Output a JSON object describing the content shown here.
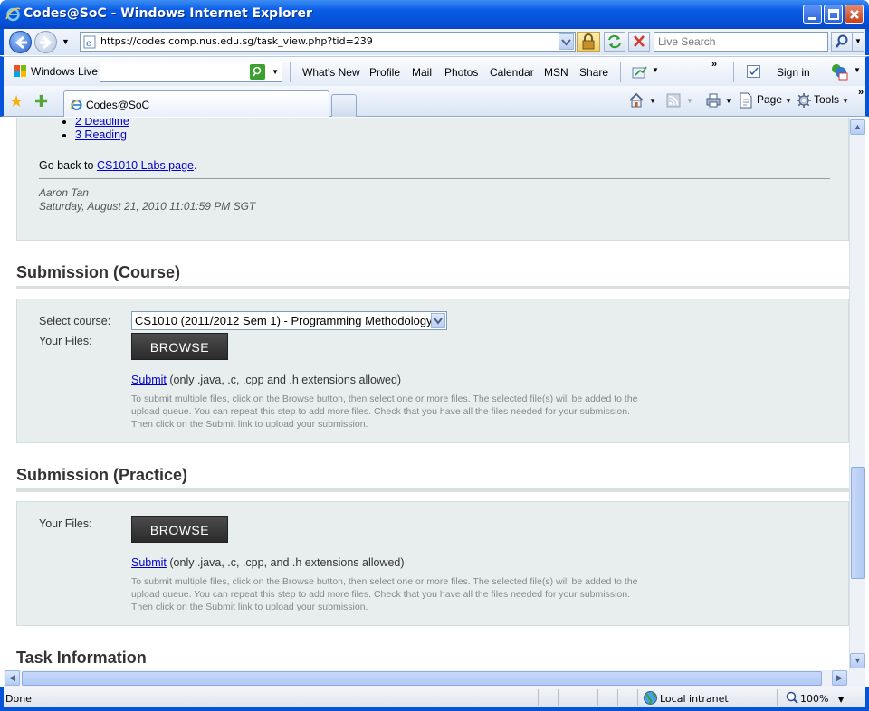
{
  "window": {
    "title": "Codes@SoC - Windows Internet Explorer"
  },
  "address_bar": {
    "url": "https://codes.comp.nus.edu.sg/task_view.php?tid=239",
    "search_placeholder": "Live Search"
  },
  "live_toolbar": {
    "brand": "Windows Live",
    "links": [
      "What's New",
      "Profile",
      "Mail",
      "Photos",
      "Calendar",
      "MSN",
      "Share"
    ],
    "sign_in": "Sign in"
  },
  "tabs": [
    {
      "label": "Codes@SoC"
    }
  ],
  "command_bar": {
    "page_label": "Page",
    "tools_label": "Tools"
  },
  "content": {
    "toc": [
      "2 Deadline",
      "3 Reading"
    ],
    "go_back_prefix": "Go back to ",
    "go_back_link": "CS1010 Labs page",
    "go_back_suffix": ".",
    "author": "Aaron Tan",
    "date": "Saturday, August 21, 2010 11:01:59 PM SGT",
    "course_section": {
      "heading": "Submission (Course)",
      "select_label": "Select course:",
      "select_value": "CS1010 (2011/2012 Sem 1) - Programming Methodology",
      "files_label": "Your Files:",
      "browse_label": "BROWSE",
      "submit_link": "Submit",
      "submit_note": " (only .java, .c, .cpp and .h extensions allowed)",
      "help_text": "To submit multiple files, click on the Browse button, then select one or more files. The selected file(s) will be added to the upload queue. You can repeat this step to add more files. Check that you have all the files needed for your submission. Then click on the Submit link to upload your submission."
    },
    "practice_section": {
      "heading": "Submission (Practice)",
      "files_label": "Your Files:",
      "browse_label": "BROWSE",
      "submit_link": "Submit",
      "submit_note": " (only .java, .c, .cpp, and .h extensions allowed)",
      "help_text": "To submit multiple files, click on the Browse button, then select one or more files. The selected file(s) will be added to the upload queue. You can repeat this step to add more files. Check that you have all the files needed for your submission. Then click on the Submit link to upload your submission."
    },
    "task_info_heading": "Task Information"
  },
  "status_bar": {
    "status": "Done",
    "zone": "Local intranet",
    "zoom": "100%"
  },
  "icons": [
    "ie-logo-icon",
    "minimize-icon",
    "maximize-icon",
    "close-icon",
    "back-icon",
    "forward-icon",
    "lock-icon",
    "refresh-icon",
    "stop-icon",
    "search-icon",
    "windows-live-icon",
    "favorites-star-icon",
    "add-favorites-icon",
    "home-icon",
    "feeds-icon",
    "print-icon",
    "page-icon",
    "tools-gear-icon",
    "globe-icon",
    "zoom-icon"
  ],
  "colors": {
    "titlebar": "#0553d9",
    "panel_bg": "#e8eeee",
    "link": "#0000cc",
    "browse_bg": "#333333"
  }
}
